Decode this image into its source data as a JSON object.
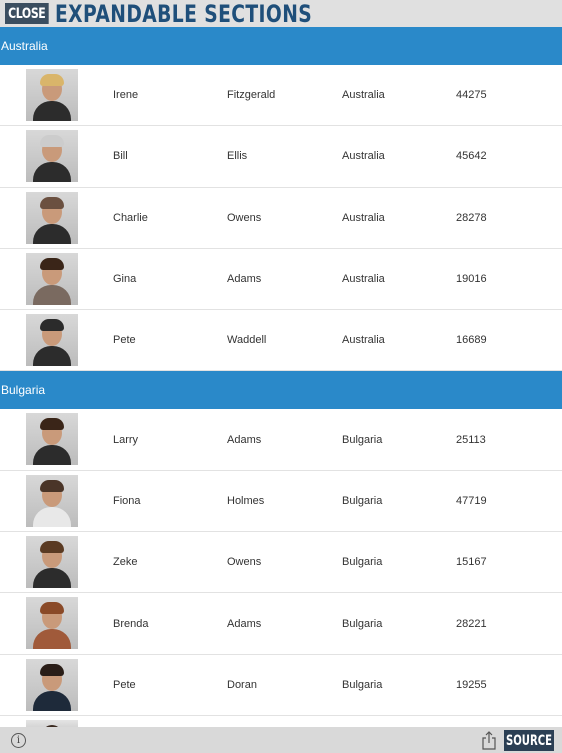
{
  "header": {
    "close_label": "CLOSE",
    "title": "EXPANDABLE SECTIONS"
  },
  "sections": [
    {
      "name": "Australia",
      "rows": [
        {
          "first": "Irene",
          "last": "Fitzgerald",
          "country": "Australia",
          "number": "44275"
        },
        {
          "first": "Bill",
          "last": "Ellis",
          "country": "Australia",
          "number": "45642"
        },
        {
          "first": "Charlie",
          "last": "Owens",
          "country": "Australia",
          "number": "28278"
        },
        {
          "first": "Gina",
          "last": "Adams",
          "country": "Australia",
          "number": "19016"
        },
        {
          "first": "Pete",
          "last": "Waddell",
          "country": "Australia",
          "number": "16689"
        }
      ]
    },
    {
      "name": "Bulgaria",
      "rows": [
        {
          "first": "Larry",
          "last": "Adams",
          "country": "Bulgaria",
          "number": "25113"
        },
        {
          "first": "Fiona",
          "last": "Holmes",
          "country": "Bulgaria",
          "number": "47719"
        },
        {
          "first": "Zeke",
          "last": "Owens",
          "country": "Bulgaria",
          "number": "15167"
        },
        {
          "first": "Brenda",
          "last": "Adams",
          "country": "Bulgaria",
          "number": "28221"
        },
        {
          "first": "Pete",
          "last": "Doran",
          "country": "Bulgaria",
          "number": "19255"
        }
      ]
    }
  ],
  "footer": {
    "info_icon": "info-icon",
    "share_icon": "share-icon",
    "source_label": "SOURCE"
  },
  "colors": {
    "section_header": "#2a89c9",
    "title": "#1f4f7a",
    "button": "#3b4e60"
  }
}
